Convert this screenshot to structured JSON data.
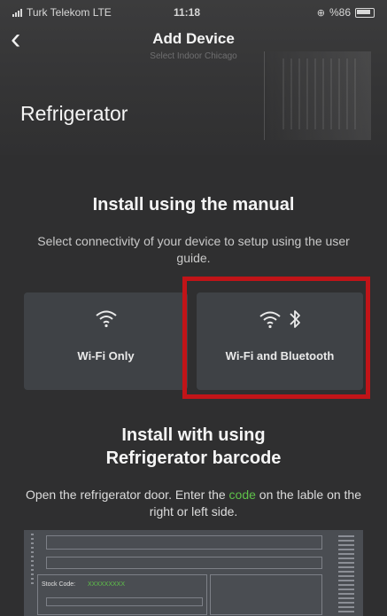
{
  "status_bar": {
    "carrier": "Turk Telekom LTE",
    "time": "11:18",
    "battery": "%86"
  },
  "nav": {
    "title": "Add Device",
    "subtitle": "Select Indoor Chicago"
  },
  "device": {
    "title": "Refrigerator"
  },
  "manual": {
    "title": "Install using the manual",
    "description": "Select connectivity of your device to setup using the user guide."
  },
  "options": [
    {
      "label": "Wi-Fi Only",
      "icons": [
        "wifi-icon"
      ]
    },
    {
      "label": "Wi-Fi and Bluetooth",
      "icons": [
        "wifi-icon",
        "bluetooth-icon"
      ],
      "highlighted": true
    }
  ],
  "barcode": {
    "title": "Install with using Refrigerator barcode",
    "description_before": "Open the refrigerator door. Enter the ",
    "code_word": "code",
    "description_after": " on the lable on the right or left side.",
    "stock_code_label": "Stock Code:",
    "stock_code_value": "XXXXXXXXX"
  },
  "colors": {
    "background": "#2f2f30",
    "card": "#3f4246",
    "highlight": "#c11418",
    "accent_green": "#5fc24a"
  }
}
